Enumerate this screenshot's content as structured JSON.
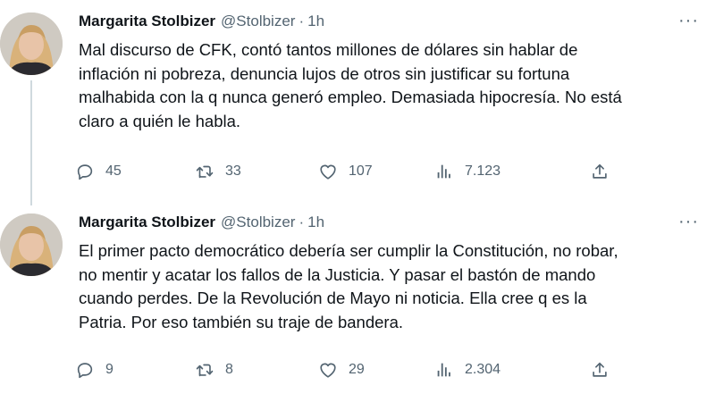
{
  "tweets": [
    {
      "author": {
        "name": "Margarita Stolbizer",
        "handle": "@Stolbizer"
      },
      "separator": "·",
      "time": "1h",
      "text": "Mal discurso de CFK, contó tantos millones de dólares sin hablar de\ninflación ni pobreza, denuncia lujos de otros sin justificar su fortuna\nmalhabida con la q nunca generó empleo. Demasiada hipocresía. No está\nclaro a quién le habla.",
      "stats": {
        "replies": "45",
        "retweets": "33",
        "likes": "107",
        "views": "7.123"
      }
    },
    {
      "author": {
        "name": "Margarita Stolbizer",
        "handle": "@Stolbizer"
      },
      "separator": "·",
      "time": "1h",
      "text": "El primer pacto democrático debería ser cumplir la Constitución, no robar,\nno mentir y acatar los fallos de la Justicia. Y pasar el bastón de mando\ncuando perdes. De la Revolución de Mayo ni noticia. Ella cree q es la\nPatria. Por eso también su traje de bandera.",
      "stats": {
        "replies": "9",
        "retweets": "8",
        "likes": "29",
        "views": "2.304"
      }
    }
  ],
  "more_label": "···",
  "icons": {
    "reply": "reply-icon",
    "retweet": "retweet-icon",
    "like": "like-icon",
    "views": "views-icon",
    "share": "share-icon",
    "more": "more-icon"
  },
  "colors": {
    "text": "#0f1419",
    "secondary": "#536471",
    "thread_line": "#cfd9de",
    "background": "#ffffff"
  }
}
